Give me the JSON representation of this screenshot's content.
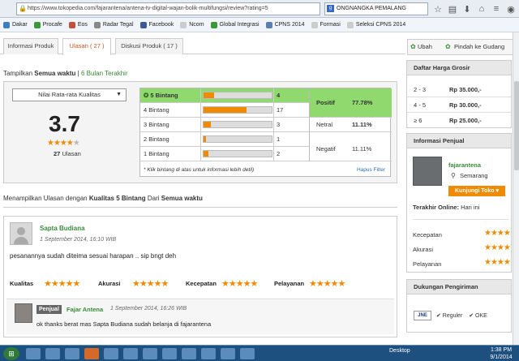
{
  "browser": {
    "url": "https://www.tokopedia.com/fajarantena/antena-tv-digital-wajan-bolik-multifungsi/review?rating=5",
    "search_value": "ONGNANGKA PEMALANG"
  },
  "bookmarks": [
    "Dakar",
    "Procafe",
    "Eos",
    "Radar Tegal",
    "Facebook",
    "Ncom",
    "Global Integrasi",
    "CPNS 2014",
    "Formasi",
    "Seleksi CPNS 2014"
  ],
  "tabs": {
    "info": "Informasi Produk",
    "ulasan": "Ulasan ( 27 )",
    "diskusi": "Diskusi Produk ( 17 )"
  },
  "actions": {
    "ubah": "Ubah",
    "pindah": "Pindah ke Gudang"
  },
  "filter": {
    "prefix": "Tampilkan",
    "semua": "Semua waktu",
    "sep": "|",
    "enam": "6 Bulan Terakhir"
  },
  "summary": {
    "dropdown": "Nilai Rata-rata Kualitas",
    "score": "3.7",
    "stars_filled": "★★★★",
    "stars_empty": "★",
    "count_num": "27",
    "count_label": "Ulasan"
  },
  "distribution": {
    "rows": [
      {
        "label": "5 Bintang",
        "count": "4",
        "fraction": 0.15
      },
      {
        "label": "4 Bintang",
        "count": "17",
        "fraction": 0.63
      },
      {
        "label": "3 Bintang",
        "count": "3",
        "fraction": 0.11
      },
      {
        "label": "2 Bintang",
        "count": "1",
        "fraction": 0.04
      },
      {
        "label": "1 Bintang",
        "count": "2",
        "fraction": 0.07
      }
    ],
    "positif_label": "Positif",
    "positif_value": "77.78%",
    "netral_label": "Netral",
    "netral_value": "11.11%",
    "negatif_label": "Negatif",
    "negatif_value": "11.11%",
    "note": "* Klik bintang di atas untuk informasi lebih detil)",
    "hapus": "Hapus Filter"
  },
  "listing": {
    "prefix": "Menampilkan Ulasan dengan",
    "kualitas": "Kualitas 5 Bintang",
    "dari": "Dari",
    "semua": "Semua waktu"
  },
  "review": {
    "name": "Sapta Budiana",
    "date": "1 September 2014, 16:10 WIB",
    "text": "pesanannya sudah diteima sesuai harapan .. sip bngt deh",
    "criteria": [
      {
        "label": "Kualitas",
        "stars": "★★★★★"
      },
      {
        "label": "Akurasi",
        "stars": "★★★★★"
      },
      {
        "label": "Kecepatan",
        "stars": "★★★★★"
      },
      {
        "label": "Pelayanan",
        "stars": "★★★★★"
      }
    ],
    "reply": {
      "badge": "Penjual",
      "name": "Fajar Antena",
      "date": "1 September 2014, 16:26 WIB",
      "text": "ok thanks berat mas Sapta Budiana sudah belanja di fajarantena"
    }
  },
  "grosir": {
    "title": "Daftar Harga Grosir",
    "rows": [
      {
        "qty": "2 - 3",
        "price": "Rp 35.000,-"
      },
      {
        "qty": "4 - 5",
        "price": "Rp 30.000,-"
      },
      {
        "qty": "≥ 6",
        "price": "Rp 25.000,-"
      }
    ]
  },
  "seller": {
    "title": "Informasi Penjual",
    "name": "fajarantena",
    "location": "Semarang",
    "visit": "Kunjungi Toko ▾",
    "online_label": "Terakhir Online:",
    "online_value": "Hari ini",
    "metrics": [
      {
        "label": "Kecepatan",
        "stars": "★★★★"
      },
      {
        "label": "Akurasi",
        "stars": "★★★★"
      },
      {
        "label": "Pelayanan",
        "stars": "★★★★"
      }
    ]
  },
  "shipping": {
    "title": "Dukungan Pengiriman",
    "logo": "JNE",
    "opt1": "✔ Reguler",
    "opt2": "✔ OKE"
  },
  "taskbar": {
    "tray": "Desktop",
    "time": "1:38 PM",
    "date": "9/1/2014"
  },
  "colors": {
    "accent_orange": "#f08a00",
    "positive_green": "#8fd96e",
    "link_green": "#3a8a3a"
  }
}
